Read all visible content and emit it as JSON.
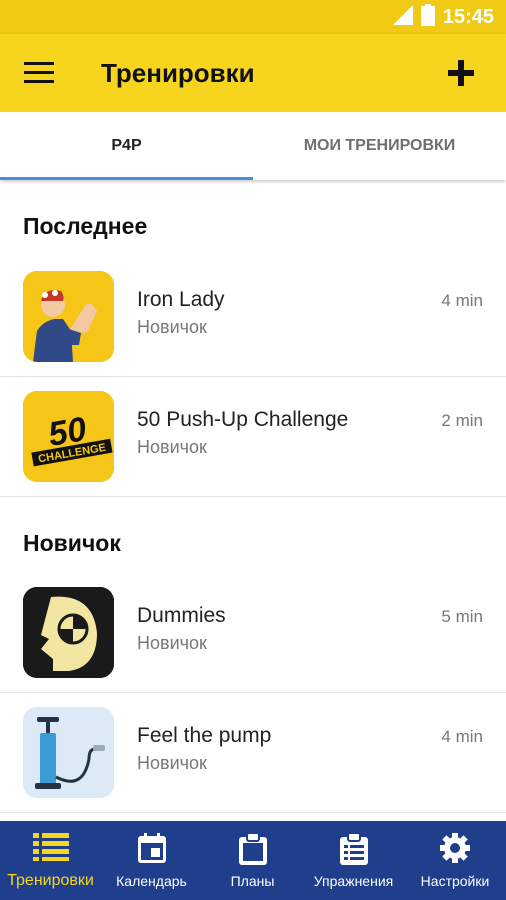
{
  "status_bar": {
    "time": "15:45"
  },
  "app_bar": {
    "title": "Тренировки"
  },
  "tabs": [
    {
      "label": "P4P"
    },
    {
      "label": "МОИ ТРЕНИРОВКИ"
    }
  ],
  "sections": [
    {
      "title": "Последнее",
      "items": [
        {
          "name": "Iron Lady",
          "level": "Новичок",
          "duration": "4 min",
          "thumb_text": ""
        },
        {
          "name": "50 Push-Up Challenge",
          "level": "Новичок",
          "duration": "2 min",
          "thumb_text": "50",
          "thumb_subtext": "CHALLENGE"
        }
      ]
    },
    {
      "title": "Новичок",
      "items": [
        {
          "name": "Dummies",
          "level": "Новичок",
          "duration": "5 min"
        },
        {
          "name": "Feel the pump",
          "level": "Новичок",
          "duration": "4 min"
        }
      ]
    }
  ],
  "bottom_nav": [
    {
      "label": "Тренировки",
      "icon": "list-icon"
    },
    {
      "label": "Календарь",
      "icon": "calendar-icon"
    },
    {
      "label": "Планы",
      "icon": "clipboard-icon"
    },
    {
      "label": "Упражнения",
      "icon": "checklist-icon"
    },
    {
      "label": "Настройки",
      "icon": "gear-icon"
    }
  ],
  "colors": {
    "primary": "#f7d51e",
    "nav": "#1f3f8c",
    "tab_indicator": "#4a8fd6"
  }
}
